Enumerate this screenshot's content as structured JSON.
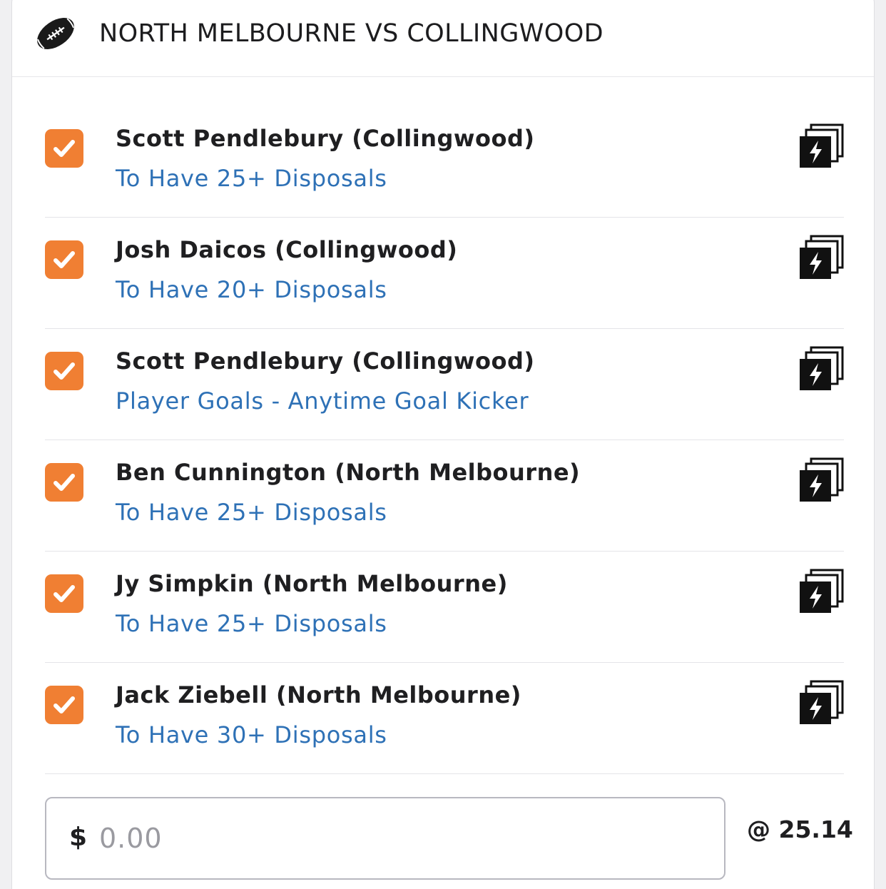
{
  "match": {
    "title": "NORTH MELBOURNE VS COLLINGWOOD",
    "sport_icon": "football-icon"
  },
  "colors": {
    "accent_orange": "#f07f33",
    "market_blue": "#2e71b6"
  },
  "legs": [
    {
      "player": "Scott Pendlebury (Collingwood)",
      "market": "To Have 25+ Disposals",
      "checked": true,
      "icon": "same-game-multi-icon"
    },
    {
      "player": "Josh Daicos (Collingwood)",
      "market": "To Have 20+ Disposals",
      "checked": true,
      "icon": "same-game-multi-icon"
    },
    {
      "player": "Scott Pendlebury (Collingwood)",
      "market": "Player Goals - Anytime Goal Kicker",
      "checked": true,
      "icon": "same-game-multi-icon"
    },
    {
      "player": "Ben Cunnington (North Melbourne)",
      "market": "To Have 25+ Disposals",
      "checked": true,
      "icon": "same-game-multi-icon"
    },
    {
      "player": "Jy Simpkin (North Melbourne)",
      "market": "To Have 25+ Disposals",
      "checked": true,
      "icon": "same-game-multi-icon"
    },
    {
      "player": "Jack Ziebell (North Melbourne)",
      "market": "To Have 30+ Disposals",
      "checked": true,
      "icon": "same-game-multi-icon"
    }
  ],
  "stake": {
    "currency": "$",
    "placeholder": "0.00",
    "value": ""
  },
  "odds": {
    "label": "@ 25.14"
  }
}
